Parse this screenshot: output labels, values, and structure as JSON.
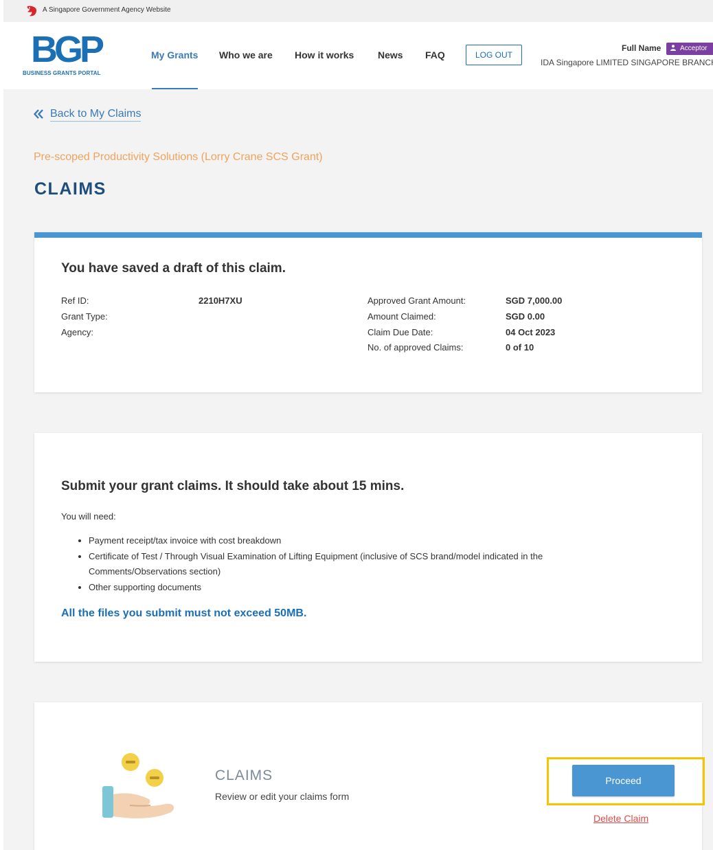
{
  "gov_banner": {
    "text": "A Singapore Government Agency Website",
    "logo_icon": "lion-head-icon",
    "logo_color": "#d9262e"
  },
  "header": {
    "logo_letters": "BGP",
    "logo_subtitle": "BUSINESS GRANTS PORTAL",
    "brand_color": "#1b6fb5",
    "nav": [
      {
        "label": "My Grants",
        "active": true
      },
      {
        "label": "Who we are",
        "active": false
      },
      {
        "label": "How it works",
        "active": false
      },
      {
        "label": "News",
        "active": false
      },
      {
        "label": "FAQ",
        "active": false
      }
    ],
    "logout_label": "LOG OUT",
    "user": {
      "name": "Full Name",
      "role": "Acceptor",
      "role_color": "#7a3fa0",
      "organisation": "IDA Singapore LIMITED SINGAPORE BRANCH"
    }
  },
  "back_link": {
    "label": "Back to My Claims",
    "icon": "double-chevron-left-icon"
  },
  "page": {
    "scheme": "Pre-scoped Productivity Solutions (Lorry Crane SCS Grant)",
    "title": "CLAIMS"
  },
  "draft_card": {
    "heading": "You have saved a draft of this claim.",
    "accent_color": "#4a96d2",
    "left_fields": [
      {
        "label": "Ref ID:",
        "value": "2210H7XU"
      },
      {
        "label": "Grant Type:",
        "value": ""
      },
      {
        "label": "Agency:",
        "value": ""
      }
    ],
    "right_fields": [
      {
        "label": "Approved Grant Amount:",
        "value": "SGD 7,000.00"
      },
      {
        "label": "Amount Claimed:",
        "value": "SGD 0.00"
      },
      {
        "label": "Claim Due Date:",
        "value": "04 Oct 2023"
      },
      {
        "label": "No. of approved Claims:",
        "value": "0 of 10"
      }
    ]
  },
  "info_card": {
    "heading": "Submit your grant claims. It should take about 15 mins.",
    "need_label": "You will need:",
    "needs": [
      "Payment receipt/tax invoice with cost breakdown",
      "Certificate of Test / Through Visual Examination of Lifting Equipment (inclusive of SCS brand/model indicated in the Comments/Observations section)",
      "Other supporting documents"
    ],
    "files_note": "All the files you submit must not exceed 50MB."
  },
  "action_card": {
    "illustration": "hand-with-coins-icon",
    "section_title": "CLAIMS",
    "section_desc": "Review or edit your claims form",
    "proceed_label": "Proceed",
    "delete_label": "Delete Claim",
    "highlight_color": "#f5c400"
  }
}
